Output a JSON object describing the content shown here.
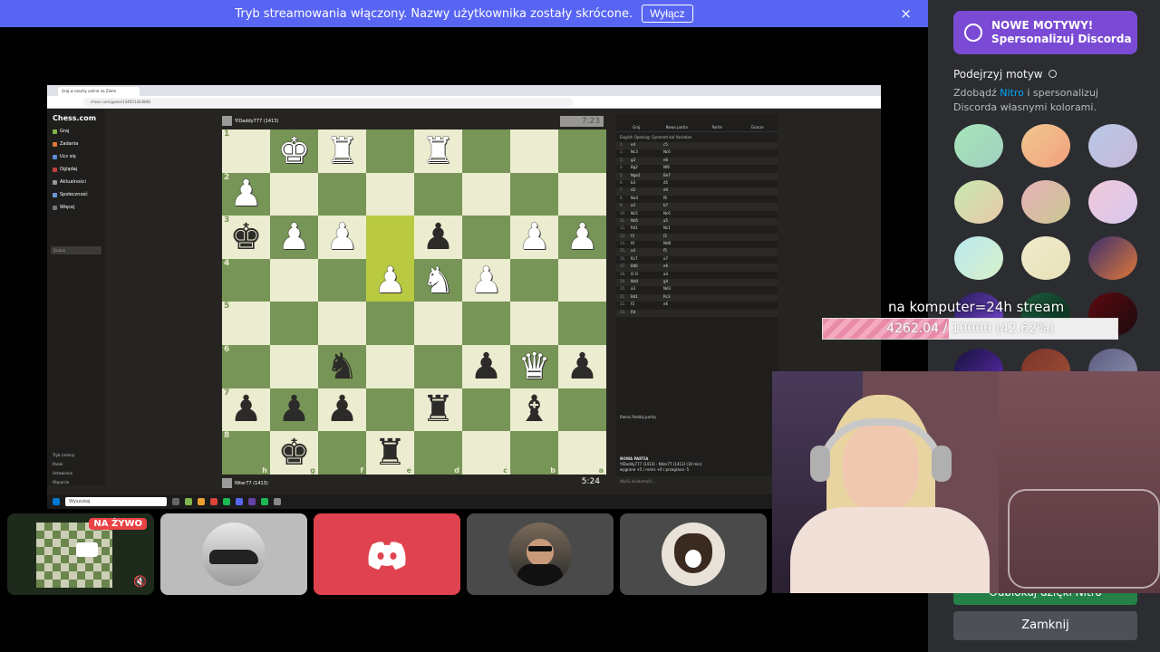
{
  "banner": {
    "message": "Tryb streamowania włączony. Nazwy użytkownika zostały skrócone.",
    "button_label": "Wyłącz",
    "close_icon": "×"
  },
  "browser": {
    "tab_title": "Graj w szachy online na Ziemi",
    "url": "chess.com/game/144051443848"
  },
  "chess": {
    "logo": "Chess.com",
    "nav": [
      "Graj",
      "Zadania",
      "Ucz się",
      "Oglądaj",
      "Aktualności",
      "Społeczność",
      "Więcej"
    ],
    "search_placeholder": "Szukaj",
    "bottom_links": [
      "Tryb ciemny",
      "Pasek",
      "Ustawienia",
      "Wsparcie"
    ],
    "top_player": "YlDaddy777 (1413)",
    "bottom_player": "Niter77 (1413)",
    "top_clock": "7:23",
    "bottom_clock": "5:24",
    "rank_labels": [
      "1",
      "2",
      "3",
      "4",
      "5",
      "6",
      "7",
      "8"
    ],
    "file_labels": [
      "h",
      "g",
      "f",
      "e",
      "d",
      "c",
      "b",
      "a"
    ],
    "board": [
      [
        "",
        "wK",
        "wR",
        "",
        "wR",
        "",
        "",
        ""
      ],
      [
        "wP",
        "",
        "",
        "",
        "",
        "",
        "",
        ""
      ],
      [
        "bK",
        "wP",
        "wP",
        "",
        "bP",
        "",
        "wP",
        "wP"
      ],
      [
        "",
        "",
        "",
        "wP",
        "wN",
        "wP",
        "",
        ""
      ],
      [
        "",
        "",
        "",
        "",
        "",
        "",
        "",
        ""
      ],
      [
        "",
        "",
        "bN",
        "",
        "",
        "bP",
        "wQ",
        "bP"
      ],
      [
        "bP",
        "bP",
        "bP",
        "",
        "bR",
        "",
        "bB",
        ""
      ],
      [
        "",
        "bK",
        "",
        "bR",
        "",
        "",
        "",
        ""
      ]
    ],
    "highlight": [
      [
        2,
        3
      ],
      [
        3,
        3
      ]
    ],
    "panel_tabs": [
      "Graj",
      "Nowa partia",
      "Partie",
      "Gracze"
    ],
    "opening": "English Opening: Symmetrical Variation",
    "moves": [
      [
        "1.",
        "e4",
        "c5"
      ],
      [
        "2.",
        "Nc3",
        "Nc6"
      ],
      [
        "3.",
        "g3",
        "e6"
      ],
      [
        "4.",
        "Bg2",
        "Nf6"
      ],
      [
        "5.",
        "Nge2",
        "Be7"
      ],
      [
        "6.",
        "b3",
        "d5"
      ],
      [
        "7.",
        "d3",
        "d4"
      ],
      [
        "8.",
        "Na4",
        "f6"
      ],
      [
        "9.",
        "a3",
        "b7"
      ],
      [
        "10.",
        "Nc5",
        "Nc6"
      ],
      [
        "11.",
        "Nd5",
        "a5"
      ],
      [
        "12.",
        "Rd1",
        "Nc1"
      ],
      [
        "13.",
        "f3",
        "f2"
      ],
      [
        "14.",
        "f4",
        "Nd8"
      ],
      [
        "15.",
        "a4",
        "f5"
      ],
      [
        "16.",
        "Rc7",
        "e7"
      ],
      [
        "17.",
        "Bd6",
        "e6"
      ],
      [
        "18.",
        "O-O",
        "a4"
      ],
      [
        "19.",
        "Nd4",
        "g4"
      ],
      [
        "20.",
        "a3",
        "Nd3"
      ],
      [
        "21.",
        "Bd1",
        "Rc3"
      ],
      [
        "22.",
        "f3",
        "e6"
      ],
      [
        "23.",
        "Rd",
        ""
      ]
    ],
    "controls_label": "Remis   Poddaj partię",
    "new_game_title": "NOWA PARTIA",
    "new_game_line1": "YlDaddy777 (1413) - Niter77 (1413) (10 min)",
    "new_game_line2": "wygrane +5 / remis +0 / przegrana -5",
    "chat_placeholder": "Wyślij wiadomość...",
    "taskbar_search": "Wyszukaj"
  },
  "tiles": {
    "live_badge": "NA ŻYWO",
    "mute_icon": "🔇"
  },
  "theme_panel": {
    "promo_line1": "NOWE MOTYWY!",
    "promo_line2": "Spersonalizuj Discorda",
    "title": "Podejrzyj motyw",
    "desc_pre": "Zdobądź",
    "desc_nitro": "Nitro",
    "desc_post": "i spersonalizuj Discorda własnymi kolorami.",
    "unlock_button": "Odblokuj dzięki Nitro",
    "close_button": "Zamknij",
    "swatches": [
      [
        "#a8e6b8",
        "#9fcfc0"
      ],
      [
        "#f0c890",
        "#f3a07e"
      ],
      [
        "#b8c8e8",
        "#c8b8d8"
      ],
      [
        "#c8eab0",
        "#e8c8a8"
      ],
      [
        "#e8b0b8",
        "#c8c890"
      ],
      [
        "#f0c8d8",
        "#d8c8f0"
      ],
      [
        "#b8e8f0",
        "#d8f0c8"
      ],
      [
        "#f0eccc",
        "#e8e0b8"
      ],
      [
        "#3a2f6e",
        "#e07838"
      ],
      [
        "#281c5c",
        "#7a4ad4"
      ],
      [
        "#1c5c3c",
        "#0a2a1c"
      ],
      [
        "#5c0a10",
        "#1a0a0c"
      ],
      [
        "#18143c",
        "#5c2ab0"
      ],
      [
        "#7a3428",
        "#a05038"
      ],
      [
        "#5c5c80",
        "#9090b0"
      ]
    ]
  },
  "overlay": {
    "goal_title": "na komputer=24h stream",
    "goal_text": "4262.04 / 10000 (42.62%)",
    "goal_progress": 0.4262
  }
}
